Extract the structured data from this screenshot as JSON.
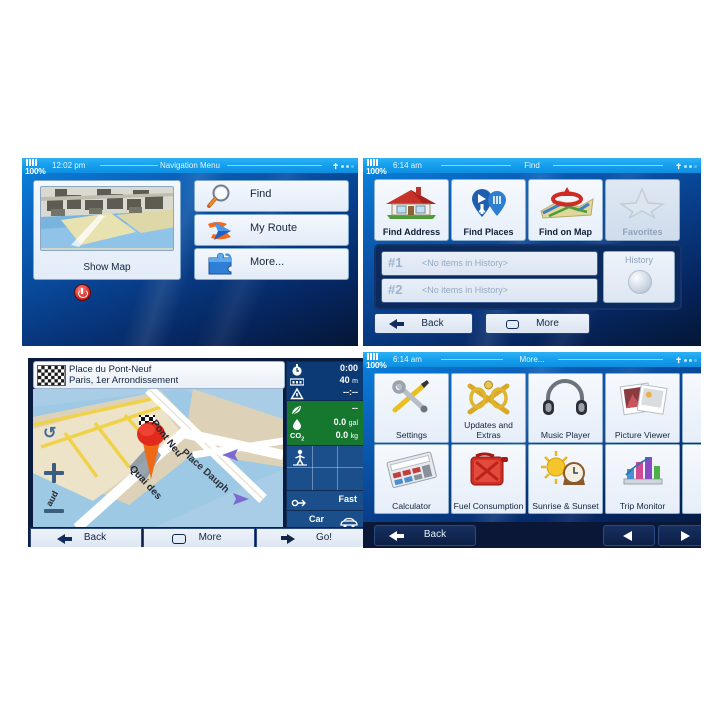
{
  "panels": {
    "nav_menu": {
      "status": {
        "battery": "100%",
        "time": "12:02 pm",
        "title": "Navigation Menu",
        "sat_icon": "satellite-icon"
      },
      "show_map": {
        "label": "Show Map",
        "thumb_icon": "3d-city-map-thumbnail"
      },
      "buttons": [
        {
          "label": "Find",
          "icon": "magnifier-icon"
        },
        {
          "label": "My Route",
          "icon": "route-arrows-icon"
        },
        {
          "label": "More...",
          "icon": "puzzle-piece-icon"
        }
      ],
      "power": {
        "icon": "power-button-icon"
      }
    },
    "find": {
      "status": {
        "battery": "100%",
        "time": "6:14 am",
        "title": "Find",
        "sat_icon": "satellite-icon"
      },
      "tiles": [
        {
          "label": "Find Address",
          "icon": "house-icon",
          "disabled": false
        },
        {
          "label": "Find Places",
          "icon": "map-pins-icon",
          "disabled": false
        },
        {
          "label": "Find on Map",
          "icon": "map-target-icon",
          "disabled": false
        },
        {
          "label": "Favorites",
          "icon": "star-icon",
          "disabled": true
        }
      ],
      "history": {
        "rows": [
          {
            "num": "#1",
            "text": "<No items in History>"
          },
          {
            "num": "#2",
            "text": "<No items in History>"
          }
        ],
        "button_label": "History",
        "button_icon": "clock-disabled-icon"
      },
      "bottom": [
        {
          "label": "Back",
          "icon": "back-arrow-icon"
        },
        {
          "label": "More",
          "icon": "menu-icon"
        }
      ]
    },
    "map": {
      "destination": {
        "line1": "Place du Pont-Neuf",
        "line2": "Paris, 1er Arrondissement",
        "icon": "checkered-flag-icon"
      },
      "map_labels": [
        "Pont Neu",
        "Quai des",
        "Place Dauph",
        "aud"
      ],
      "controls": {
        "zoom_in": "plus-icon",
        "zoom_out": "minus-icon",
        "compass": "rotate-icon"
      },
      "sidebar": {
        "eta": [
          {
            "icon": "stopwatch-icon",
            "value": "0:00"
          },
          {
            "icon": "distance-icon",
            "value": "40",
            "unit": "m"
          },
          {
            "icon": "arrival-icon",
            "value": "--:--"
          }
        ],
        "eco": [
          {
            "icon": "leaf-icon",
            "value": "--"
          },
          {
            "icon": "fuel-drop-icon",
            "value": "0.0",
            "unit": "gal"
          },
          {
            "icon": "co2-icon",
            "label": "CO",
            "sub": "2",
            "value": "0.0",
            "unit": "kg"
          }
        ],
        "pedestrian_icon": "pedestrian-icon",
        "route_method": {
          "icon": "route-icon",
          "label": "Fast"
        },
        "vehicle": {
          "label": "Car",
          "icon": "car-icon"
        }
      },
      "bottom": [
        {
          "label": "Back",
          "icon": "back-arrow-icon"
        },
        {
          "label": "More",
          "icon": "menu-icon"
        },
        {
          "label": "Go!",
          "icon": "forward-arrow-icon"
        }
      ]
    },
    "more": {
      "status": {
        "battery": "100%",
        "time": "6:14 am",
        "title": "More...",
        "sat_icon": "satellite-icon"
      },
      "tiles": [
        {
          "label": "Settings",
          "icon": "tools-icon"
        },
        {
          "label": "Updates and Extras",
          "icon": "updates-icon"
        },
        {
          "label": "Music Player",
          "icon": "headphones-icon"
        },
        {
          "label": "Picture Viewer",
          "icon": "photos-icon"
        },
        {
          "label": "",
          "icon": "cut-off-icon"
        },
        {
          "label": "Calculator",
          "icon": "calculator-icon"
        },
        {
          "label": "Fuel Consumption",
          "icon": "jerrycan-icon"
        },
        {
          "label": "Sunrise & Sunset",
          "icon": "sun-clock-icon"
        },
        {
          "label": "Trip Monitor",
          "icon": "bar-chart-icon"
        },
        {
          "label": "",
          "icon": "cut-off-icon"
        }
      ],
      "bottom": {
        "back_label": "Back",
        "prev_icon": "prev-arrow-icon",
        "next_icon": "next-arrow-icon"
      }
    }
  },
  "colors": {
    "title_bar": "#16a0ee",
    "panel_bg_light": "#0b86e2",
    "panel_bg_dark": "#041634",
    "eco_green": "#16782f",
    "eta_blue": "#0c3a74",
    "tile_face": "#f0f5fc"
  }
}
